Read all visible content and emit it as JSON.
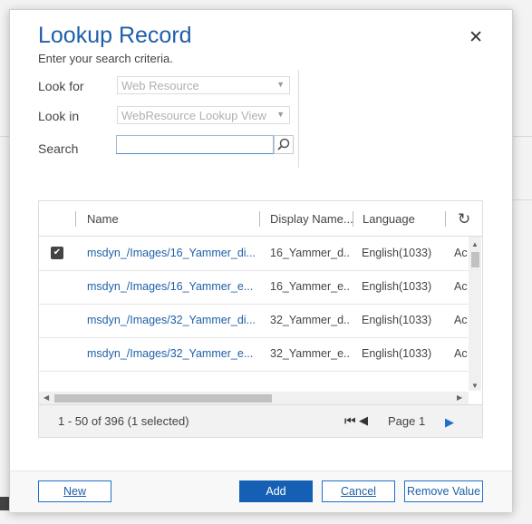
{
  "dialog": {
    "title": "Lookup Record",
    "subtitle": "Enter your search criteria.",
    "close_glyph": "✕"
  },
  "criteria": {
    "look_for_label": "Look for",
    "look_for_value": "Web Resource",
    "look_in_label": "Look in",
    "look_in_value": "WebResource Lookup View",
    "search_label": "Search",
    "search_value": "",
    "search_placeholder": ""
  },
  "grid": {
    "columns": [
      "Name",
      "Display Name...",
      "Language"
    ],
    "rows": [
      {
        "name": "msdyn_/Images/16_Yammer_di...",
        "display": "16_Yammer_d...",
        "language": "English(1033)",
        "status": "Ac",
        "selected": true
      },
      {
        "name": "msdyn_/Images/16_Yammer_e...",
        "display": "16_Yammer_e...",
        "language": "English(1033)",
        "status": "Ac",
        "selected": false
      },
      {
        "name": "msdyn_/Images/32_Yammer_di...",
        "display": "32_Yammer_d...",
        "language": "English(1033)",
        "status": "Ac",
        "selected": false
      },
      {
        "name": "msdyn_/Images/32_Yammer_e...",
        "display": "32_Yammer_e...",
        "language": "English(1033)",
        "status": "Ac",
        "selected": false
      }
    ],
    "record_count": "1 - 50 of 396 (1 selected)",
    "page_label": "Page 1"
  },
  "buttons": {
    "new": "New",
    "add": "Add",
    "cancel": "Cancel",
    "remove": "Remove Value"
  },
  "colors": {
    "accent": "#1f5fa8",
    "primary_button": "#1560b4"
  }
}
